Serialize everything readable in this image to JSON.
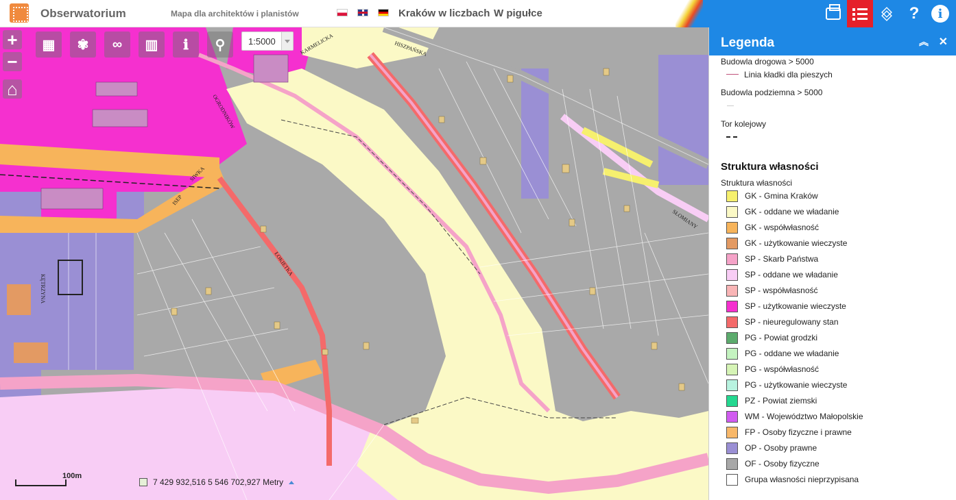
{
  "header": {
    "app_title": "Obserwatorium",
    "subtitle": "Mapa dla architektów i planistów",
    "nav": [
      "Kraków w liczbach",
      "W pigułce"
    ]
  },
  "map": {
    "scale_value": "1:5000",
    "scale_bar_label": "100m",
    "coordinates": "7 429 932,516  5 546 702,927 Metry",
    "street_labels": [
      "KARMELICKA",
      "HISZPAŃSKA",
      "SIWKA",
      "ISEP",
      "OGRODNIKÓW",
      "ŁOKIETKA",
      "KĘTRZYNA",
      "SŁOMIANY"
    ]
  },
  "legend": {
    "title": "Legenda",
    "groups": [
      {
        "title": "Budowla drogowa > 5000",
        "line_label": "Linia kładki dla pieszych",
        "line_color": "#c0527a"
      },
      {
        "title": "Budowla podziemna > 5000",
        "line_label": "",
        "line_color": "#cccccc"
      },
      {
        "title": "Tor kolejowy",
        "line_label": "",
        "line_color": "#222222"
      }
    ],
    "section_title": "Struktura własności",
    "section_sub": "Struktura własności",
    "items": [
      {
        "label": "GK - Gmina Kraków",
        "color": "#f6f06e"
      },
      {
        "label": "GK - oddane we władanie",
        "color": "#fbf9c6"
      },
      {
        "label": "GK - współwłasność",
        "color": "#f7b45b"
      },
      {
        "label": "GK - użytkowanie wieczyste",
        "color": "#e39a63"
      },
      {
        "label": "SP - Skarb Państwa",
        "color": "#f5a3c8"
      },
      {
        "label": "SP - oddane we władanie",
        "color": "#f8cdf5"
      },
      {
        "label": "SP - współwłasność",
        "color": "#f9b5b6"
      },
      {
        "label": "SP - użytkowanie wieczyste",
        "color": "#f530cf"
      },
      {
        "label": "SP - nieuregulowany stan",
        "color": "#f46a6a"
      },
      {
        "label": "PG - Powiat grodzki",
        "color": "#5cab6d"
      },
      {
        "label": "PG - oddane we władanie",
        "color": "#c4f3c0"
      },
      {
        "label": "PG - współwłasność",
        "color": "#d6f4b6"
      },
      {
        "label": "PG - użytkowanie wieczyste",
        "color": "#b8f3e0"
      },
      {
        "label": "PZ - Powiat ziemski",
        "color": "#24d890"
      },
      {
        "label": "WM - Województwo Małopolskie",
        "color": "#d15cf0"
      },
      {
        "label": "FP - Osoby fizyczne i prawne",
        "color": "#f8b86a"
      },
      {
        "label": "OP - Osoby prawne",
        "color": "#9a8fd4"
      },
      {
        "label": "OF - Osoby fizyczne",
        "color": "#a8a8a8"
      },
      {
        "label": "Grupa własności nieprzypisana",
        "color": "#ffffff"
      }
    ]
  }
}
